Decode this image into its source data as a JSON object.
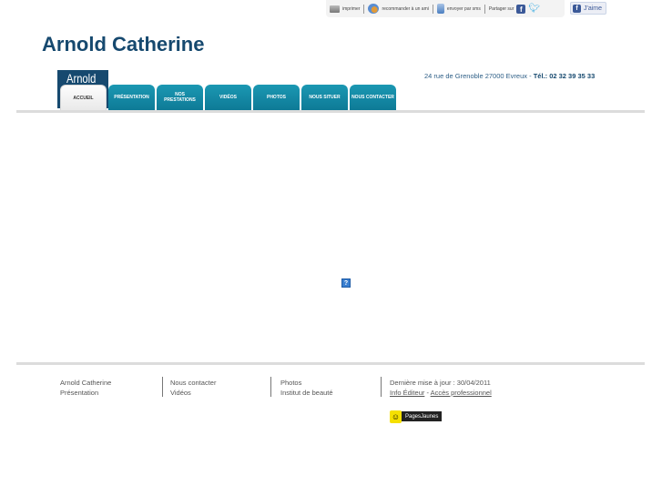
{
  "toolbar": {
    "print_label": "imprimer",
    "recommend_label": "recommander à un ami",
    "sms_label": "envoyer par sms",
    "share_label": "Partager sur",
    "like_label": "J'aime"
  },
  "header": {
    "site_title": "Arnold Catherine",
    "logo_text": "Arnold",
    "address": "24 rue de Grenoble 27000 Evreux",
    "address_sep": "-",
    "tel_label": "Tél.: 02 32 39 35 33"
  },
  "nav": {
    "tabs": [
      {
        "label": "ACCUEIL",
        "active": true
      },
      {
        "label": "PRÉSENTATION",
        "active": false
      },
      {
        "label": "NOS PRESTATIONS",
        "active": false
      },
      {
        "label": "VIDÉOS",
        "active": false
      },
      {
        "label": "PHOTOS",
        "active": false
      },
      {
        "label": "NOUS SITUER",
        "active": false
      },
      {
        "label": "NOUS CONTACTER",
        "active": false
      }
    ]
  },
  "content": {
    "plugin_placeholder_icon": "?"
  },
  "footer": {
    "col1": [
      "Arnold Catherine",
      "Présentation"
    ],
    "col2": [
      "Nous contacter",
      "Vidéos"
    ],
    "col3": [
      "Photos",
      "Institut de beauté"
    ],
    "last_update": "Dernière mise à jour : 30/04/2011",
    "info_editeur": "Info Éditeur",
    "link_sep": "-",
    "acces_pro": "Accès professionnel",
    "badge_icon": "☺",
    "badge_text": "PagesJaunes"
  },
  "colors": {
    "brand_dark_blue": "#16496f",
    "tab_teal": "#1189a5",
    "badge_yellow": "#f5e000"
  }
}
